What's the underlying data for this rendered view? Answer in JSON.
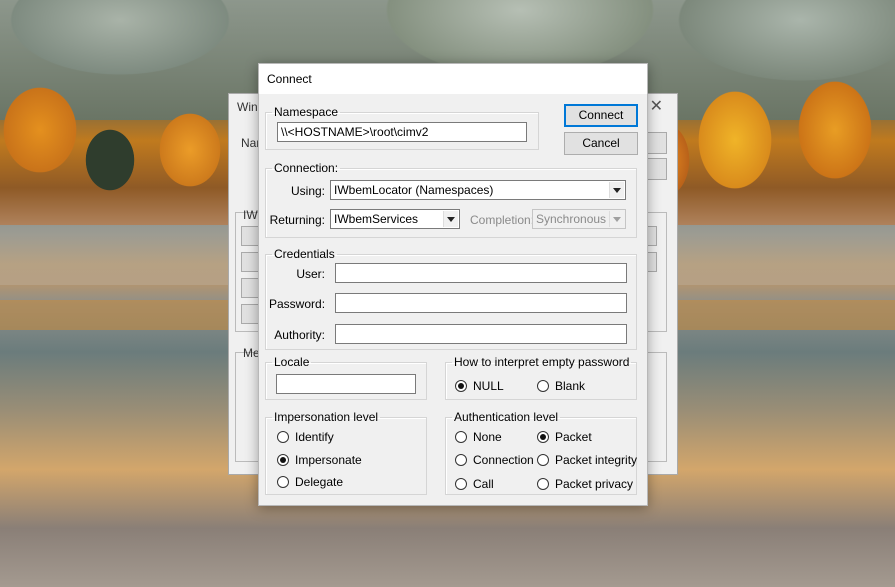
{
  "background_window": {
    "title": "Win",
    "label_namespace": "Nam",
    "group_label": "IWl",
    "method_label": "Met",
    "close_glyph": "✕"
  },
  "dialog": {
    "title": "Connect",
    "namespace": {
      "legend": "Namespace",
      "value": "\\\\<HOSTNAME>\\root\\cimv2"
    },
    "buttons": {
      "connect": "Connect",
      "cancel": "Cancel"
    },
    "connection": {
      "legend": "Connection:",
      "using_label": "Using:",
      "using_value": "IWbemLocator (Namespaces)",
      "returning_label": "Returning:",
      "returning_value": "IWbemServices",
      "completion_label": "Completion:",
      "completion_value": "Synchronous"
    },
    "credentials": {
      "legend": "Credentials",
      "user_label": "User:",
      "user_value": "",
      "password_label": "Password:",
      "password_value": "",
      "authority_label": "Authority:",
      "authority_value": ""
    },
    "locale": {
      "legend": "Locale",
      "value": ""
    },
    "empty_password": {
      "legend": "How to interpret empty password",
      "options": [
        "NULL",
        "Blank"
      ],
      "selected": "NULL"
    },
    "impersonation": {
      "legend": "Impersonation level",
      "options": [
        "Identify",
        "Impersonate",
        "Delegate"
      ],
      "selected": "Impersonate"
    },
    "authentication": {
      "legend": "Authentication level",
      "options": [
        "None",
        "Packet",
        "Connection",
        "Packet integrity",
        "Call",
        "Packet privacy"
      ],
      "selected": "Packet"
    }
  }
}
